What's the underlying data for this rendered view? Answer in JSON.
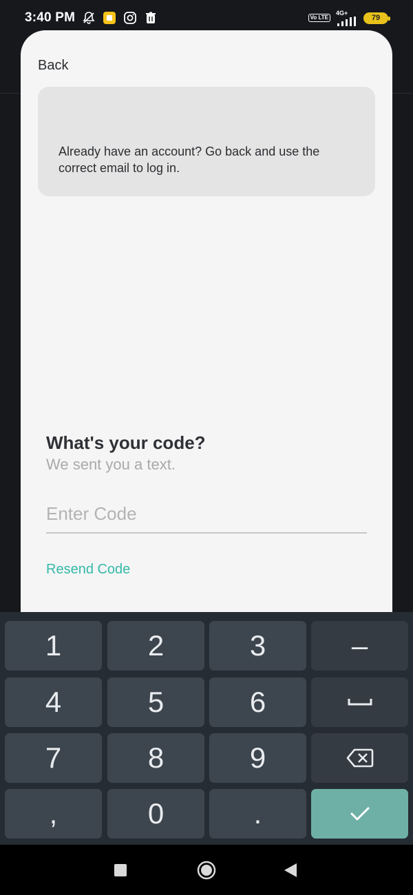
{
  "status_bar": {
    "time": "3:40 PM",
    "network": "4G+",
    "volte": "Vo LTE",
    "battery": "79"
  },
  "sheet": {
    "back_label": "Back",
    "notice": "Already have an account? Go back and use the correct email to log in.",
    "title": "What's your code?",
    "subtitle": "We sent you a text.",
    "code_placeholder": "Enter Code",
    "code_value": "",
    "resend_label": "Resend Code",
    "accent_color": "#34b9a8"
  },
  "keyboard": {
    "keys": [
      "1",
      "2",
      "3",
      "–",
      "4",
      "5",
      "6",
      "space",
      "7",
      "8",
      "9",
      "backspace",
      ",",
      "0",
      ".",
      "enter"
    ],
    "labels": {
      "k1": "1",
      "k2": "2",
      "k3": "3",
      "dash": "–",
      "k4": "4",
      "k5": "5",
      "k6": "6",
      "k7": "7",
      "k8": "8",
      "k9": "9",
      "comma": ",",
      "k0": "0",
      "period": "."
    }
  },
  "navbar": {
    "icons": [
      "recents-square-icon",
      "home-circle-icon",
      "back-triangle-icon"
    ]
  }
}
